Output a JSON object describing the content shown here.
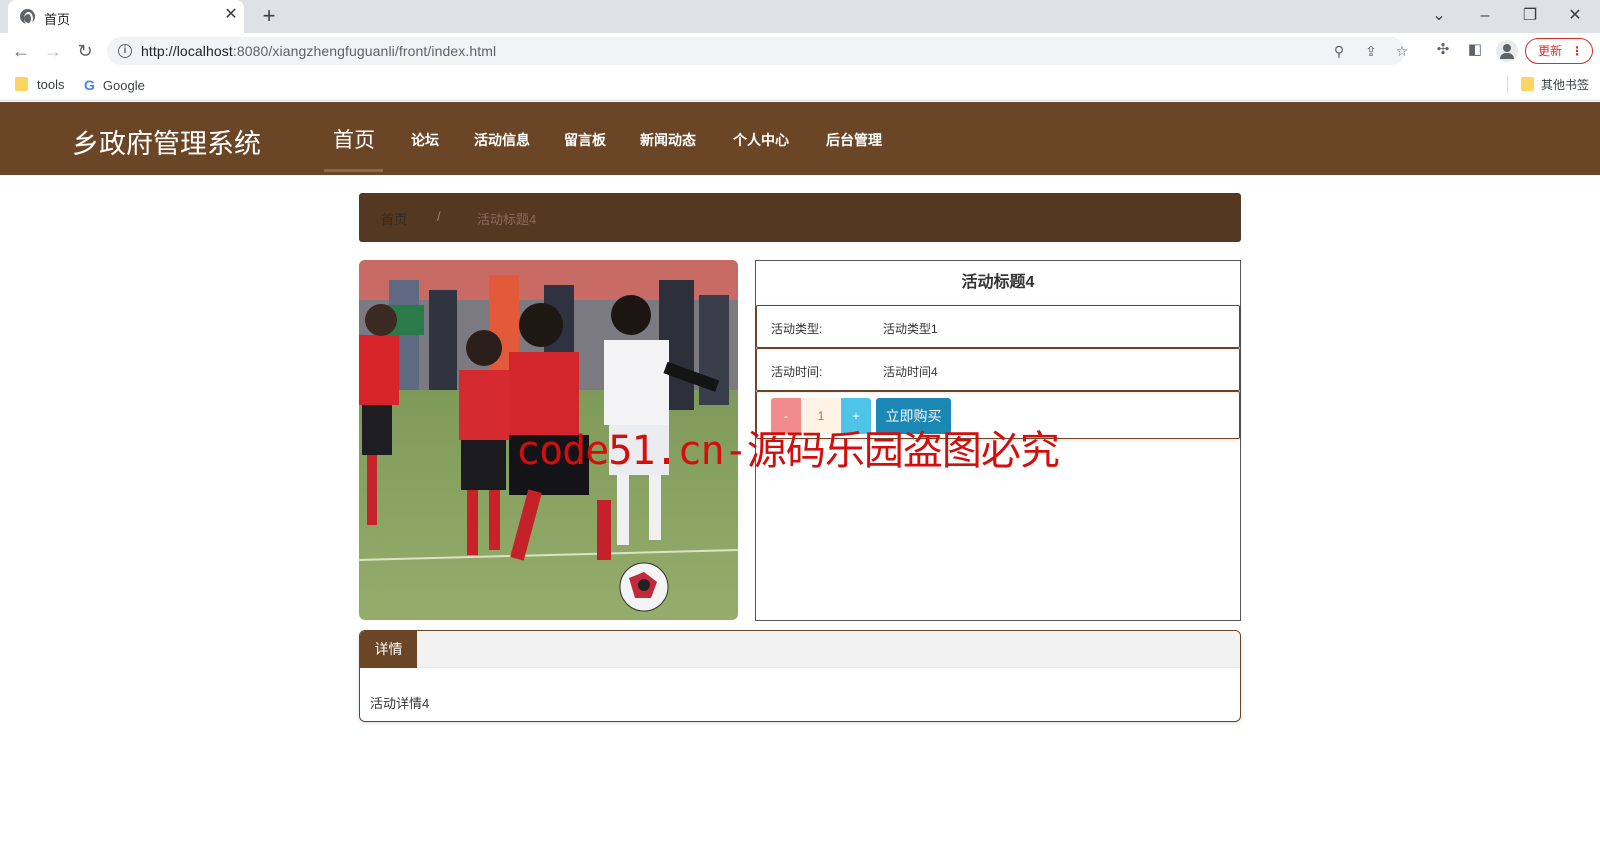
{
  "browser": {
    "tab_title": "首页",
    "tab_close": "✕",
    "new_tab": "+",
    "url_host": "http://localhost",
    "url_rest": ":8080/xiangzhengfuguanli/front/index.html",
    "update_label": "更新",
    "menu_dots": "⋮",
    "bookmarks": [
      {
        "label": "tools",
        "icon": "folder-icon"
      },
      {
        "label": "Google",
        "icon": "google-icon"
      }
    ],
    "other_bookmarks": "其他书签"
  },
  "site": {
    "brand": "乡政府管理系统",
    "nav": [
      "首页",
      "论坛",
      "活动信息",
      "留言板",
      "新闻动态",
      "个人中心",
      "后台管理"
    ]
  },
  "breadcrumb": {
    "home": "首页",
    "separator": "/",
    "current": "活动标题4"
  },
  "detail": {
    "title": "活动标题4",
    "type_label": "活动类型:",
    "type_value": "活动类型1",
    "time_label": "活动时间:",
    "time_value": "活动时间4",
    "qty_minus": "-",
    "qty_value": "1",
    "qty_plus": "+",
    "buy_label": "立即购买"
  },
  "panel": {
    "tab_label": "详情",
    "content": "活动详情4"
  },
  "watermark": "code51.cn-源码乐园盗图必究",
  "colors": {
    "header_brown": "#6b4626",
    "breadcrumb_brown": "#553821",
    "buy_blue": "#1b87b5",
    "watermark_red": "#d40d0d"
  }
}
